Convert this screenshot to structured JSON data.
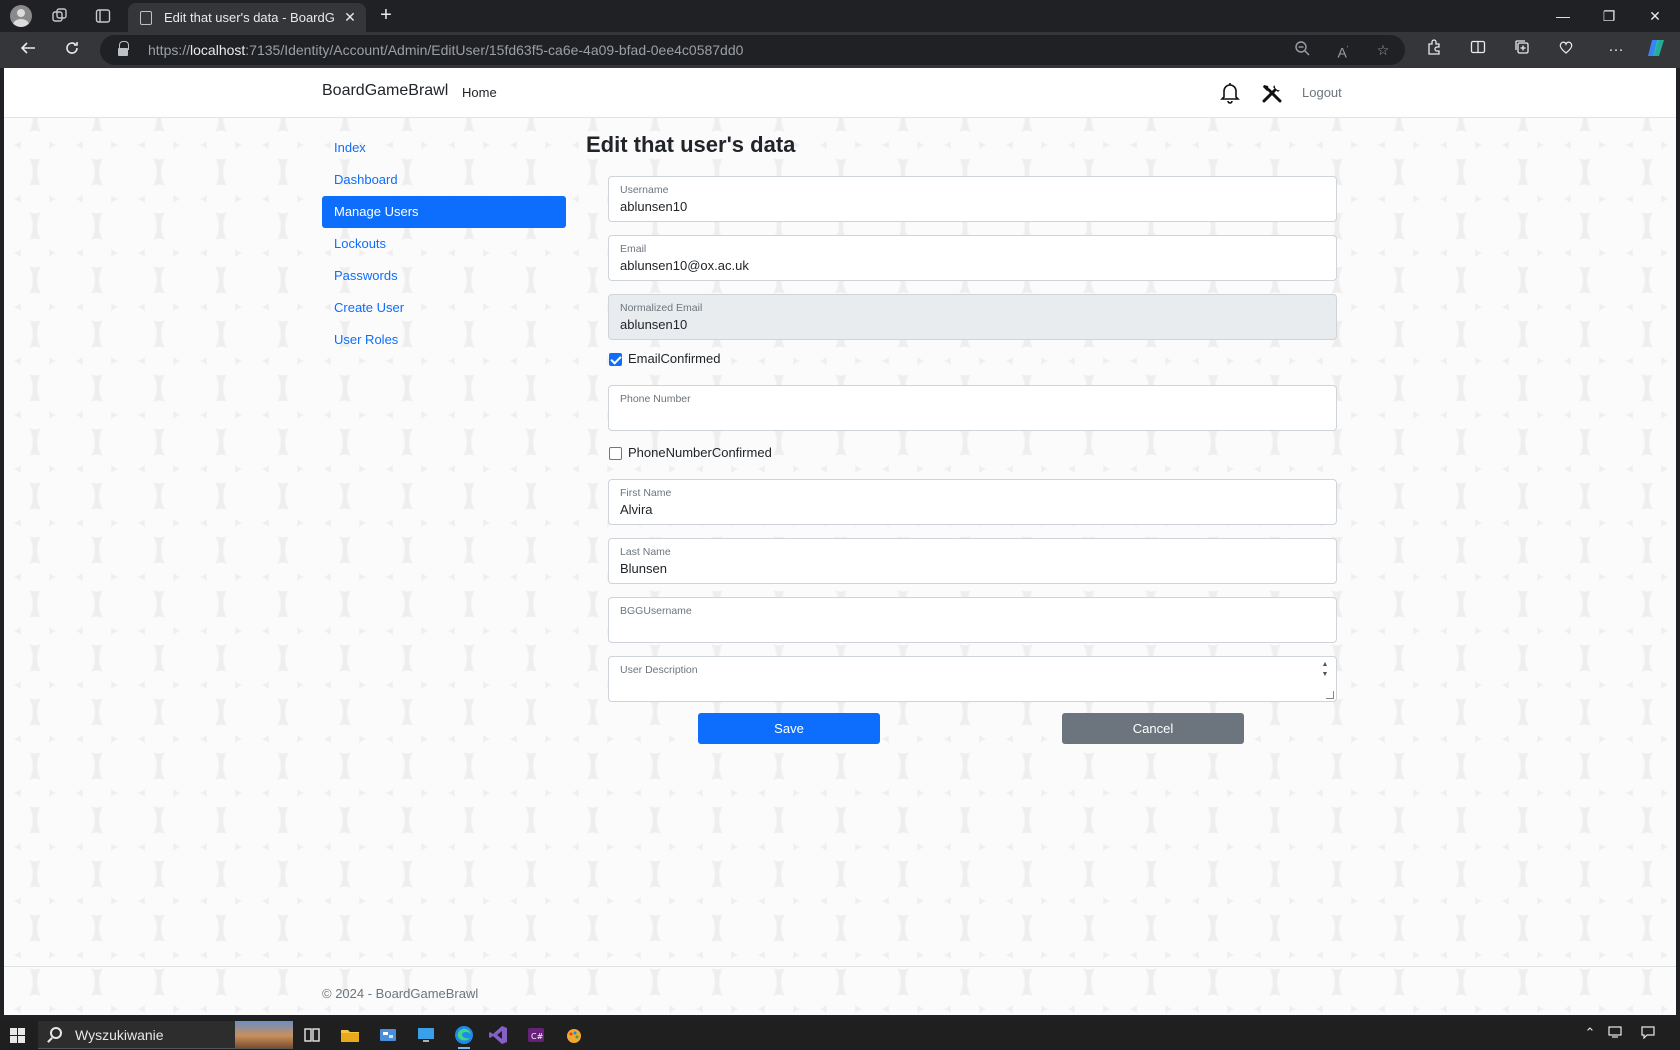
{
  "browser": {
    "tab_title": "Edit that user's data - BoardGam",
    "tab_close": "✕",
    "new_tab": "+",
    "url_prefix": "https://",
    "url_host": "localhost",
    "url_rest": ":7135/Identity/Account/Admin/EditUser/15fd63f5-ca6e-4a09-bfad-0ee4c0587dd0",
    "window_minimize": "—",
    "window_restore": "❐",
    "window_close": "✕"
  },
  "navbar": {
    "brand": "BoardGameBrawl",
    "home": "Home",
    "logout": "Logout"
  },
  "sidebar": {
    "items": [
      {
        "label": "Index",
        "active": false
      },
      {
        "label": "Dashboard",
        "active": false
      },
      {
        "label": "Manage Users",
        "active": true
      },
      {
        "label": "Lockouts",
        "active": false
      },
      {
        "label": "Passwords",
        "active": false
      },
      {
        "label": "Create User",
        "active": false
      },
      {
        "label": "User Roles",
        "active": false
      }
    ]
  },
  "page": {
    "title": "Edit that user's data"
  },
  "form": {
    "username": {
      "label": "Username",
      "value": "ablunsen10"
    },
    "email": {
      "label": "Email",
      "value": "ablunsen10@ox.ac.uk"
    },
    "normalized_email": {
      "label": "Normalized Email",
      "value": "ablunsen10"
    },
    "email_confirmed": {
      "label": "EmailConfirmed",
      "checked": true
    },
    "phone_number": {
      "label": "Phone Number",
      "value": ""
    },
    "phone_confirmed": {
      "label": "PhoneNumberConfirmed",
      "checked": false
    },
    "first_name": {
      "label": "First Name",
      "value": "Alvira"
    },
    "last_name": {
      "label": "Last Name",
      "value": "Blunsen"
    },
    "bgg_username": {
      "label": "BGGUsername",
      "value": ""
    },
    "user_description": {
      "label": "User Description",
      "value": ""
    },
    "save_label": "Save",
    "cancel_label": "Cancel"
  },
  "footer": {
    "text": "© 2024 - BoardGameBrawl"
  },
  "taskbar": {
    "search_placeholder": "Wyszukiwanie"
  },
  "colors": {
    "primary": "#0d6efd",
    "secondary": "#6c757d"
  }
}
